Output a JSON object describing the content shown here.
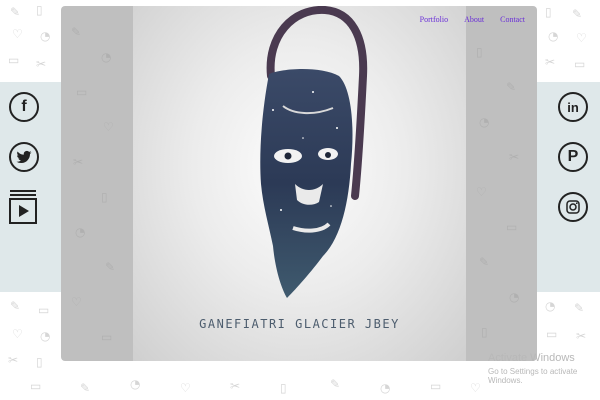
{
  "nav": {
    "links": [
      "Portfolio",
      "About",
      "Contact"
    ]
  },
  "hero": {
    "title": "GANEFIATRI GLACIER JBEY"
  },
  "social_left": [
    "facebook-icon",
    "twitter-icon",
    "video-icon"
  ],
  "social_right": [
    "linkedin-icon",
    "pinterest-icon",
    "instagram-icon"
  ],
  "watermark": {
    "title": "Activate Windows",
    "subtitle": "Go to Settings to activate Windows."
  },
  "colors": {
    "nav_link": "#6a2fd8",
    "side_panel": "#dfe8ea",
    "card": "#bfbfbf",
    "title_text": "#4d5d6e"
  }
}
